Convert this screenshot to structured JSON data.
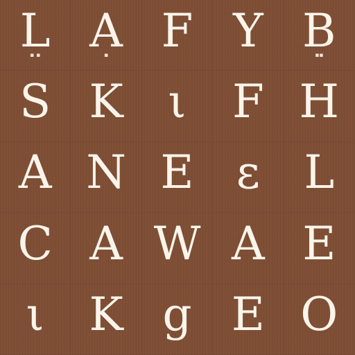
{
  "board": {
    "background_color": "#7f4f35",
    "letter_color": "#fbf4ea"
  },
  "cells": [
    [
      "L",
      "A",
      "F",
      "Y",
      "B"
    ],
    [
      "S",
      "K",
      "ι",
      "F",
      "H"
    ],
    [
      "A",
      "N",
      "E",
      "ɛ",
      "L"
    ],
    [
      "C",
      "A",
      "W",
      "A",
      "E"
    ],
    [
      "ι",
      "K",
      "g",
      "E",
      "O"
    ]
  ]
}
